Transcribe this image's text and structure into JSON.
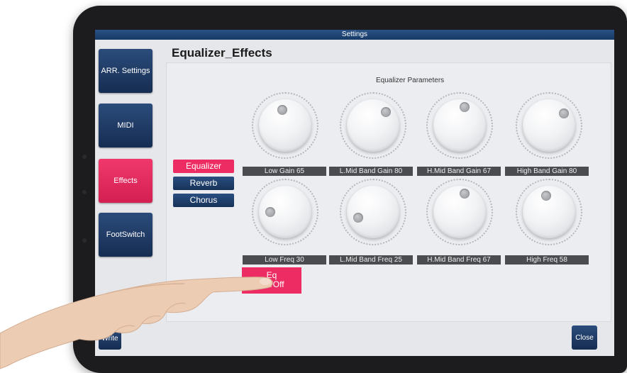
{
  "window": {
    "title": "Settings"
  },
  "sidebar": {
    "items": [
      {
        "label": "ARR. Settings",
        "active": false
      },
      {
        "label": "MIDI",
        "active": false
      },
      {
        "label": "Effects",
        "active": true
      },
      {
        "label": "FootSwitch",
        "active": false
      }
    ]
  },
  "page": {
    "title": "Equalizer_Effects"
  },
  "section": {
    "title": "Equalizer Parameters"
  },
  "categories": [
    {
      "label": "Equalizer",
      "active": true
    },
    {
      "label": "Reverb",
      "active": false
    },
    {
      "label": "Chorus",
      "active": false
    }
  ],
  "knobs": {
    "row1": [
      {
        "label": "Low Gain 65",
        "value": 65
      },
      {
        "label": "L.Mid Band Gain 80",
        "value": 80
      },
      {
        "label": "H.Mid Band Gain 67",
        "value": 67
      },
      {
        "label": "High Band Gain 80",
        "value": 80
      }
    ],
    "row2": [
      {
        "label": "Low Freq 30",
        "value": 30
      },
      {
        "label": "L.Mid Band Freq 25",
        "value": 25
      },
      {
        "label": "H.Mid Band Freq 67",
        "value": 67
      },
      {
        "label": "High Freq 58",
        "value": 58
      }
    ]
  },
  "eq_toggle": {
    "line1": "Eq",
    "line2": "On/Off"
  },
  "footer": {
    "write_label": "Write",
    "close_label": "Close"
  },
  "colors": {
    "accent": "#ec2c62",
    "button_blue": "#1f3f6c",
    "titlebar": "#1f4676"
  }
}
